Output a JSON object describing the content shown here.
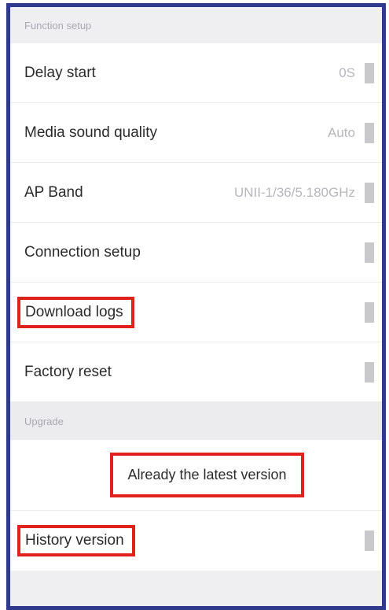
{
  "function_setup": {
    "header": "Function setup",
    "items": [
      {
        "label": "Delay start",
        "value": "0S"
      },
      {
        "label": "Media sound quality",
        "value": "Auto"
      },
      {
        "label": "AP Band",
        "value": "UNII-1/36/5.180GHz"
      },
      {
        "label": "Connection setup",
        "value": ""
      },
      {
        "label": "Download logs",
        "value": "",
        "highlighted": true
      },
      {
        "label": "Factory reset",
        "value": ""
      }
    ]
  },
  "upgrade": {
    "header": "Upgrade",
    "status_button": "Already the latest version",
    "history_label": "History version"
  },
  "colors": {
    "frame_border": "#2f3a8f",
    "highlight": "#e1221c",
    "section_bg": "#efeff2"
  }
}
